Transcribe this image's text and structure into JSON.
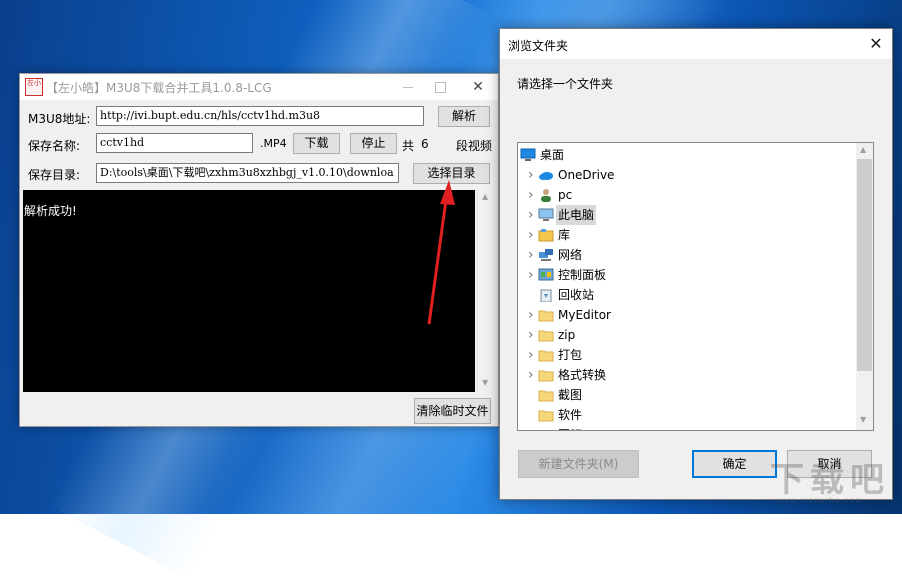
{
  "tool": {
    "icon_text": "左小",
    "title": "【左小皓】M3U8下载合并工具1.0.8-LCG",
    "m3u8_label": "M3U8地址:",
    "m3u8_value": "http://ivi.bupt.edu.cn/hls/cctv1hd.m3u8",
    "parse_button": "解析",
    "save_name_label": "保存名称:",
    "save_name_value": "cctv1hd",
    "ext": ".MP4",
    "download_button": "下载",
    "stop_button": "停止",
    "total_prefix": "共",
    "total_count": "6",
    "total_suffix": "段视频",
    "save_dir_label": "保存目录:",
    "save_dir_value": "D:\\tools\\桌面\\下载吧\\zxhm3u8xzhbgj_v1.0.10\\downloa",
    "select_dir_button": "选择目录",
    "console_text": "解析成功!",
    "clear_temp_button": "清除临时文件"
  },
  "dialog": {
    "title": "浏览文件夹",
    "prompt": "请选择一个文件夹",
    "tree": [
      {
        "label": "桌面",
        "expandable": false,
        "icon": "desktop-icon",
        "indent": 0,
        "selected": false
      },
      {
        "label": "OneDrive",
        "expandable": true,
        "icon": "cloud-icon",
        "indent": 1,
        "selected": false
      },
      {
        "label": "pc",
        "expandable": true,
        "icon": "user-icon",
        "indent": 1,
        "selected": false
      },
      {
        "label": "此电脑",
        "expandable": true,
        "icon": "computer-icon",
        "indent": 1,
        "selected": true
      },
      {
        "label": "库",
        "expandable": true,
        "icon": "library-icon",
        "indent": 1,
        "selected": false
      },
      {
        "label": "网络",
        "expandable": true,
        "icon": "network-icon",
        "indent": 1,
        "selected": false
      },
      {
        "label": "控制面板",
        "expandable": true,
        "icon": "control-panel-icon",
        "indent": 1,
        "selected": false
      },
      {
        "label": "回收站",
        "expandable": false,
        "icon": "recycle-bin-icon",
        "indent": 1,
        "selected": false
      },
      {
        "label": "MyEditor",
        "expandable": true,
        "icon": "folder-icon",
        "indent": 1,
        "selected": false
      },
      {
        "label": "zip",
        "expandable": true,
        "icon": "folder-icon",
        "indent": 1,
        "selected": false
      },
      {
        "label": "打包",
        "expandable": true,
        "icon": "folder-icon",
        "indent": 1,
        "selected": false
      },
      {
        "label": "格式转换",
        "expandable": true,
        "icon": "folder-icon",
        "indent": 1,
        "selected": false
      },
      {
        "label": "截图",
        "expandable": false,
        "icon": "folder-icon",
        "indent": 1,
        "selected": false
      },
      {
        "label": "软件",
        "expandable": false,
        "icon": "folder-icon",
        "indent": 1,
        "selected": false
      },
      {
        "label": "图标",
        "expandable": false,
        "icon": "folder-icon",
        "indent": 1,
        "selected": false
      }
    ],
    "new_folder_button": "新建文件夹(M)",
    "ok_button": "确定",
    "cancel_button": "取消"
  },
  "colors": {
    "accent": "#0078d7",
    "annotation_arrow": "#e02020"
  }
}
